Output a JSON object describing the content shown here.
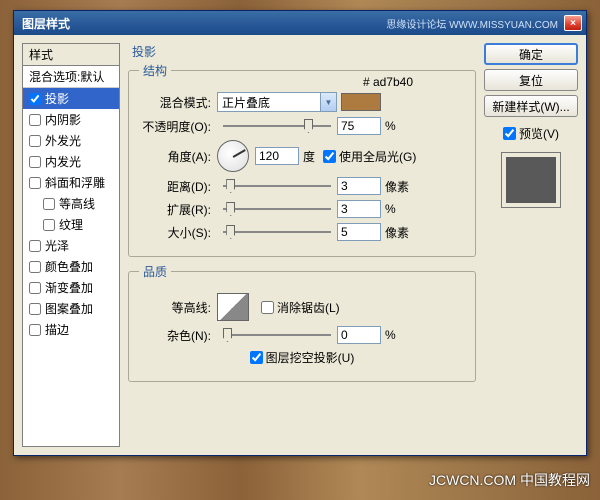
{
  "window": {
    "title": "图层样式",
    "tag": "思缘设计论坛 WWW.MISSYUAN.COM",
    "close": "×"
  },
  "sidebar": {
    "header": "样式",
    "sub": "混合选项:默认",
    "items": [
      {
        "label": "投影",
        "checked": true,
        "selected": true
      },
      {
        "label": "内阴影",
        "checked": false
      },
      {
        "label": "外发光",
        "checked": false
      },
      {
        "label": "内发光",
        "checked": false
      },
      {
        "label": "斜面和浮雕",
        "checked": false
      },
      {
        "label": "等高线",
        "checked": false,
        "indent": true
      },
      {
        "label": "纹理",
        "checked": false,
        "indent": true
      },
      {
        "label": "光泽",
        "checked": false
      },
      {
        "label": "颜色叠加",
        "checked": false
      },
      {
        "label": "渐变叠加",
        "checked": false
      },
      {
        "label": "图案叠加",
        "checked": false
      },
      {
        "label": "描边",
        "checked": false
      }
    ]
  },
  "center": {
    "title": "投影",
    "group1_legend": "结构",
    "group2_legend": "品质",
    "hex": "# ad7b40",
    "blend_label": "混合模式:",
    "blend_value": "正片叠底",
    "opacity_label": "不透明度(O):",
    "opacity_value": "75",
    "percent": "%",
    "angle_label": "角度(A):",
    "angle_value": "120",
    "angle_unit": "度",
    "global_light": "使用全局光(G)",
    "distance_label": "距离(D):",
    "distance_value": "3",
    "px": "像素",
    "spread_label": "扩展(R):",
    "spread_value": "3",
    "size_label": "大小(S):",
    "size_value": "5",
    "contour_label": "等高线:",
    "antialias": "消除锯齿(L)",
    "noise_label": "杂色(N):",
    "noise_value": "0",
    "knockout": "图层挖空投影(U)"
  },
  "buttons": {
    "ok": "确定",
    "reset": "复位",
    "new_style": "新建样式(W)...",
    "preview": "预览(V)"
  },
  "footer": "JCWCN.COM 中国教程网"
}
